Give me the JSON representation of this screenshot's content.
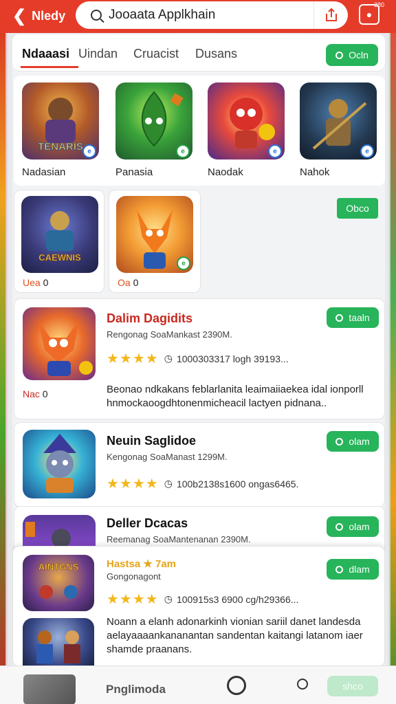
{
  "topbar": {
    "back_label": "Nledy",
    "search_value": "Jooaata Applkhain",
    "store_badge": "280"
  },
  "tabs": [
    {
      "label": "Ndaaasi"
    },
    {
      "label": "Uindan"
    },
    {
      "label": "Cruacist"
    },
    {
      "label": "Dusans"
    }
  ],
  "tabs_button": "Ocln",
  "grid_row1": [
    {
      "name": "Nadasian",
      "art_text": "TENARIS"
    },
    {
      "name": "Panasia"
    },
    {
      "name": "Naodak"
    },
    {
      "name": "Nahok"
    }
  ],
  "grid_row2": [
    {
      "tag": "Uea",
      "tag_suffix": "0",
      "art_text": "CAEWNIS"
    },
    {
      "tag": "Oa",
      "tag_suffix": "0"
    }
  ],
  "grid_row2_button": "Obco",
  "list": [
    {
      "title": "Dalim Dagidits",
      "subtitle": "Rengonag SoaMankast 2390M.",
      "rating_text": "1000303317 logh 39193...",
      "button": "taaln",
      "tag": "Nac",
      "tag_suffix": "0",
      "description": "Beonao ndkakans feblarlanita leaimaiiaekea idal ionporll hnmockaoogdhtonenmicheacil lactyen pidnana.."
    },
    {
      "title": "Neuin Saglidoe",
      "subtitle": "Kengonag SoaManast 1299M.",
      "rating_text": "100b2138s1600 ongas6465.",
      "button": "olam"
    },
    {
      "title": "Deller Dcacas",
      "subtitle": "Reemanag SoaMantenanan 2390M.",
      "button": "olam"
    },
    {
      "title": "Hastsa ★ 7am",
      "subtitle": "Gongonagont",
      "rating_text": "100915s3 6900 cg/h29366...",
      "button": "dlam",
      "art_text": "AINTGNS",
      "description": "Noann a elanh adonarkinh vionian sariil danet landesda aelayaaaankananantan sandentan kaitangi latanom iaer shamde praanans."
    }
  ],
  "bottombar": {
    "label": "Pnglimoda",
    "button": "shco"
  },
  "colors": {
    "brand_red": "#e53c2a",
    "green": "#27b45a",
    "star": "#f3b71b"
  }
}
